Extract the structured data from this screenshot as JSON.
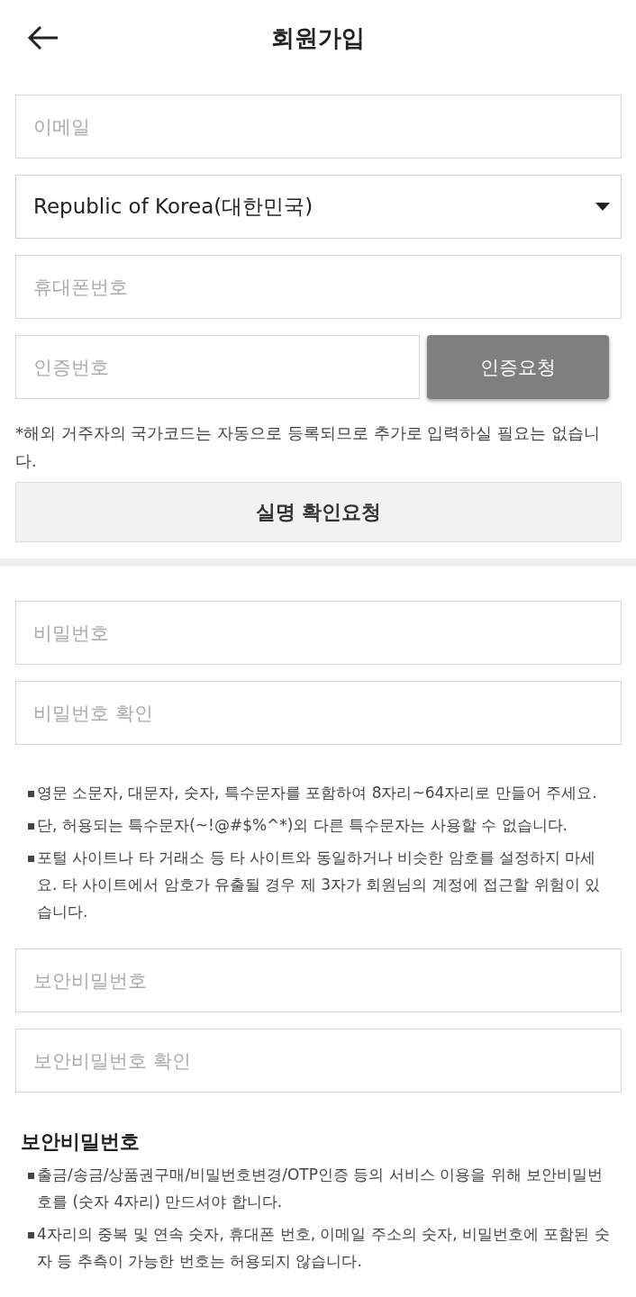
{
  "header": {
    "title": "회원가입"
  },
  "form_top": {
    "email": {
      "placeholder": "이메일"
    },
    "country": {
      "value": "Republic of Korea(대한민국)"
    },
    "phone": {
      "placeholder": "휴대폰번호"
    },
    "auth_code": {
      "placeholder": "인증번호"
    },
    "auth_button": "인증요청",
    "notice": "*해외 거주자의 국가코드는 자동으로 등록되므로 추가로 입력하실 필요는 없습니다.",
    "verify_button": "실명 확인요청"
  },
  "password": {
    "fields": [
      {
        "placeholder": "비밀번호"
      },
      {
        "placeholder": "비밀번호 확인"
      }
    ],
    "rules": [
      "영문 소문자, 대문자, 숫자, 특수문자를 포함하여 8자리~64자리로 만들어 주세요.",
      "단, 허용되는 특수문자(~!@#$%^*)외 다른 특수문자는 사용할 수 없습니다.",
      "포털 사이트나 타 거래소 등 타 사이트와 동일하거나 비슷한 암호를 설정하지 마세요. 타 사이트에서 암호가 유출될 경우 제 3자가 회원님의 계정에 접근할 위험이 있습니다."
    ]
  },
  "security_pin": {
    "fields": [
      {
        "placeholder": "보안비밀번호"
      },
      {
        "placeholder": "보안비밀번호 확인"
      }
    ],
    "heading": "보안비밀번호",
    "rules": [
      "출금/송금/상품권구매/비밀번호변경/OTP인증 등의 서비스 이용을 위해 보안비밀번호를 (숫자 4자리) 만드셔야 합니다.",
      "4자리의 중복 및 연속 숫자, 휴대폰 번호, 이메일 주소의 숫자, 비밀번호에 포함된 숫자 등 추측이 가능한 번호는 허용되지 않습니다."
    ]
  }
}
